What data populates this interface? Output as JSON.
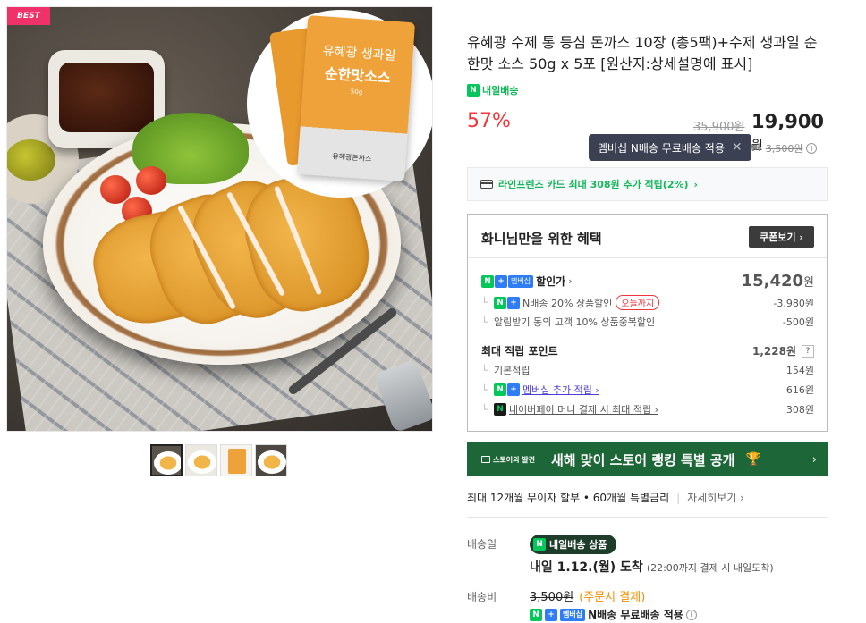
{
  "gallery": {
    "badge": "BEST",
    "sauce_pack": {
      "title": "유혜광 생과일",
      "subtitle": "순한맛소스",
      "weight": "50g",
      "brand": "유혜광돈까스"
    },
    "thumbnail_count": 4,
    "active_thumbnail": 1
  },
  "product": {
    "title": "유혜광 수제 통 등심 돈까스 10장 (총5팩)+수제 생과일 순한맛 소스 50g x 5포 [원산지:상세설명에 표시]",
    "delivery_tag": "내일배송",
    "discount_rate": "57%",
    "original_price": "35,900원",
    "sale_price": "19,900",
    "price_unit": "원"
  },
  "tooltip": {
    "text": "멤버십 N배송 무료배송 적용",
    "close": "✕"
  },
  "shipping_mini": {
    "icon": "truck-icon",
    "fee": "3,500원"
  },
  "card_banner": {
    "text": "라인프렌즈 카드 최대 308원 추가 적립(2%)",
    "arrow": "›"
  },
  "benefits": {
    "heading": "화니님만을 위한 혜택",
    "coupon_button": "쿠폰보기 ›",
    "discount_label": "할인가",
    "discount_price": "15,420",
    "discount_unit": "원",
    "discount_items": [
      {
        "label": "N배송 20% 상품할인",
        "chip": "오늘까지",
        "value": "-3,980원"
      },
      {
        "label": "알림받기 동의 고객 10% 상품중복할인",
        "value": "-500원"
      }
    ],
    "points_label": "최대 적립 포인트",
    "points_value": "1,228원",
    "points_help": "?",
    "points_items": [
      {
        "label": "기본적립",
        "value": "154원"
      },
      {
        "label": "멤버십 추가 적립 ›",
        "value": "616원"
      },
      {
        "label": "네이버페이 머니 결제 시 최대 적립 ›",
        "value": "308원"
      }
    ],
    "member_tag": "멤버십",
    "n_label": "N",
    "plus_label": "+"
  },
  "rank_banner": {
    "small_label": "스토어의 발견",
    "title": "새해 맞이 스토어 랭킹 특별 공개",
    "arrow": "›"
  },
  "installment": {
    "text": "최대 12개월 무이자 할부 • 60개월 특별금리",
    "more": "자세히보기 ›"
  },
  "shipping": {
    "date_label": "배송일",
    "pill": "내일배송 상품",
    "arrival": "내일 1.12.(월) 도착",
    "arrival_note": "(22:00까지 결제 시 내일도착)",
    "fee_label": "배송비",
    "fee_original": "3,500원",
    "fee_condition": "(주문시 결제)",
    "free_text": "N배송 무료배송 적용"
  },
  "colors": {
    "accent_red": "#f1353b",
    "naver_green": "#03c75a",
    "banner_green": "#1d6638",
    "membership_blue": "#2e7cf6",
    "purple_link": "#4d3fd6"
  }
}
